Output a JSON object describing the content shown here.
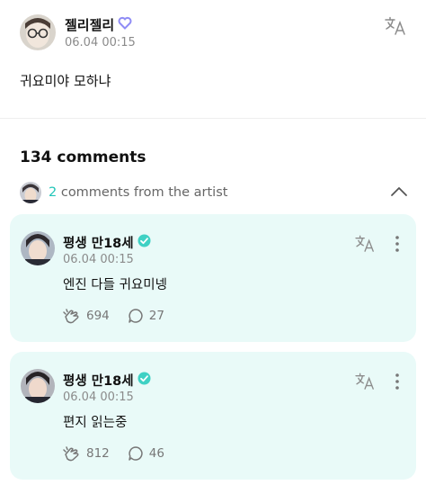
{
  "post": {
    "author": "젤리젤리",
    "time": "06.04 00:15",
    "body": "귀요미야 모하냐",
    "badge_color": "#8f8cf5",
    "translate_icon": "translate-icon"
  },
  "comments": {
    "count_label": "134 comments",
    "artist": {
      "count": "2",
      "label": " comments from the artist",
      "accent": "#22c5b8"
    },
    "items": [
      {
        "author": "평생 만18세",
        "time": "06.04 00:15",
        "body": "엔진 다들 귀요미넹",
        "likes": "694",
        "replies": "27"
      },
      {
        "author": "평생 만18세",
        "time": "06.04 00:15",
        "body": "편지 읽는중",
        "likes": "812",
        "replies": "46"
      }
    ]
  },
  "colors": {
    "card_bg": "#e9faf8",
    "verified": "#3fd1c4",
    "muted": "#8b8b8b"
  }
}
